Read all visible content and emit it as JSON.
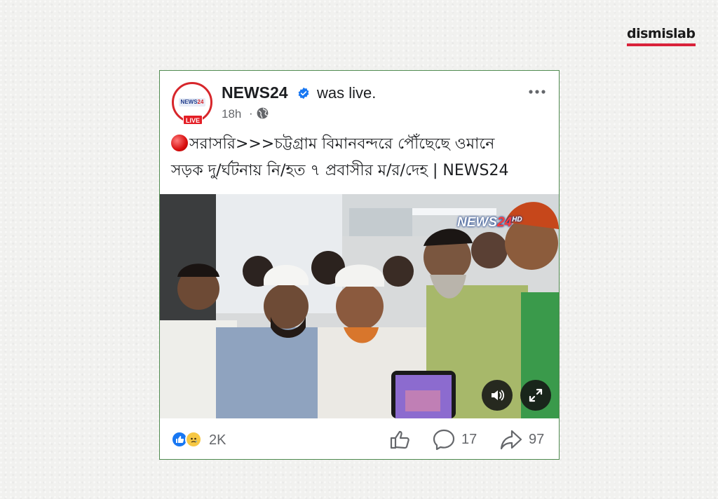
{
  "brand": {
    "logo_text": "dismislab",
    "accent": "#d9223a"
  },
  "post": {
    "avatar": {
      "logo_text": "NEWS",
      "logo_num": "24",
      "live_badge": "LIVE"
    },
    "page_name": "NEWS24",
    "verified_icon": "verified-badge-icon",
    "status": "was live.",
    "time": "18h",
    "separator": "·",
    "privacy_icon": "globe-icon",
    "more_icon": "more-options-icon",
    "title_line1": "সরাসরি>>>চট্টগ্রাম বিমানবন্দরে পৌঁছেছে ওমানে",
    "title_line2": "সড়ক দু/র্ঘটনায় নি/হত ৭ প্রবাসীর ম/র/দেহ | NEWS24",
    "video": {
      "watermark_main": "NEWS",
      "watermark_num": "24",
      "watermark_hd": "HD",
      "volume_icon": "speaker-icon",
      "fullscreen_icon": "expand-icon"
    },
    "footer": {
      "reactions": [
        "like-reaction-icon",
        "sad-reaction-icon"
      ],
      "reaction_count": "2K",
      "comment_count": "17",
      "share_count": "97"
    }
  },
  "colors": {
    "card_border": "#4f8a4f",
    "facebook_blue": "#1877f2",
    "live_red": "#e41e26",
    "secondary_text": "#65676b"
  }
}
